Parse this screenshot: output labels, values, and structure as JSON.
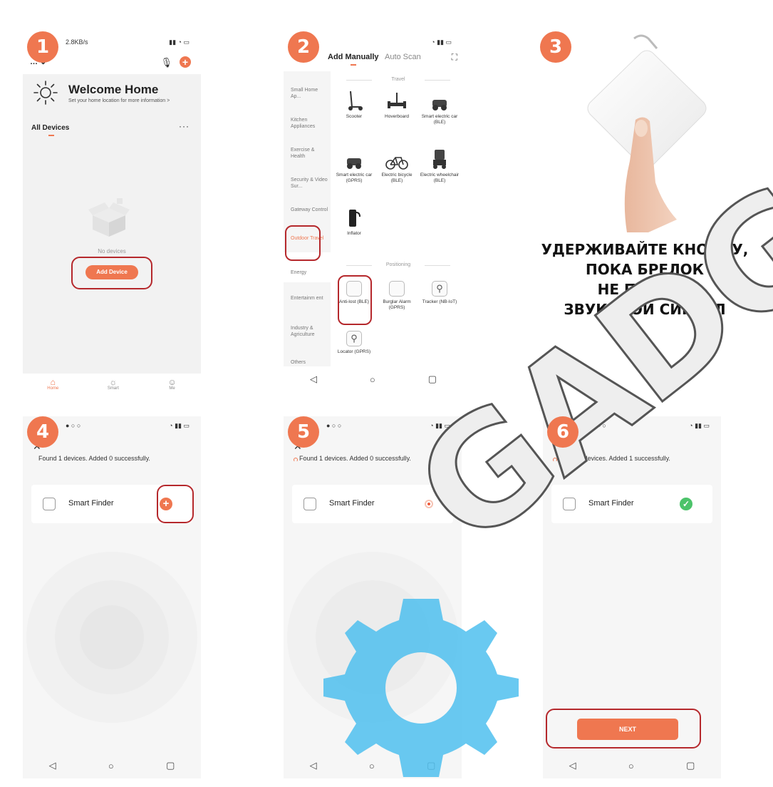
{
  "steps": [
    "1",
    "2",
    "3",
    "4",
    "5",
    "6"
  ],
  "accent": "#ef7750",
  "highlight": "#b5282c",
  "p1": {
    "status_speed": "2.8KB/s",
    "home_name": "…",
    "welcome_title": "Welcome Home",
    "welcome_sub": "Set your home location for more information >",
    "all_devices": "All Devices",
    "more": "···",
    "no_devices": "No devices",
    "add_device": "Add Device",
    "tabs": [
      {
        "label": "Home",
        "icon": "home-icon"
      },
      {
        "label": "Smart",
        "icon": "sun-icon"
      },
      {
        "label": "Me",
        "icon": "user-icon"
      }
    ]
  },
  "p2": {
    "tab_manual": "Add Manually",
    "tab_scan": "Auto Scan",
    "categories": [
      "Small Home Ap...",
      "Kitchen Appliances",
      "Exercise & Health",
      "Security & Video Sur...",
      "Gateway Control",
      "Outdoor Travel",
      "Energy",
      "Entertainm ent",
      "Industry & Agriculture",
      "Others"
    ],
    "section_travel": "Travel",
    "section_positioning": "Positioning",
    "travel_items": [
      "Scooter",
      "Hoverboard",
      "Smart electric car (BLE)",
      "Smart electric car (GPRS)",
      "Electric bicycle (BLE)",
      "Electric wheelchair (BLE)",
      "Inflator"
    ],
    "positioning_items": [
      "Anti-lost (BLE)",
      "Burglar Alarm (GPRS)",
      "Tracker (NB-IoT)",
      "Locator (GPRS)"
    ]
  },
  "p3": {
    "instruction_lines": [
      "УДЕРЖИВАЙТЕ КНОПКУ,",
      "ПОКА БРЕЛОК",
      "НЕ ПОДАСТ",
      "ЗВУКОВОЙ СИГНАЛ"
    ]
  },
  "p4": {
    "found": "Found 1 devices. Added 0 successfully.",
    "device": "Smart Finder"
  },
  "p5": {
    "found": "Found 1 devices. Added 0 successfully.",
    "device": "Smart Finder"
  },
  "p6": {
    "found": "Found 1 devices. Added 1 successfully.",
    "device": "Smart Finder",
    "next": "NEXT"
  },
  "watermark": "GADG"
}
